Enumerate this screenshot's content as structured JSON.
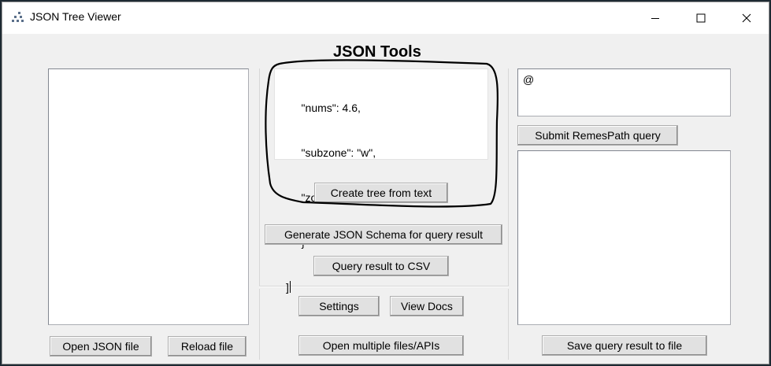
{
  "window": {
    "title": "JSON Tree Viewer",
    "controls": {
      "minimize_icon": "minimize-icon",
      "maximize_icon": "maximize-icon",
      "close_icon": "close-icon"
    }
  },
  "heading": "JSON Tools",
  "json_text": {
    "lines": [
      "    \"nums\": 4.6,",
      "    \"subzone\": \"w\",",
      "    \"zone\": 5",
      "    }",
      "]"
    ]
  },
  "buttons": {
    "create_tree": "Create tree from text",
    "generate_schema": "Generate JSON Schema for query result",
    "query_to_csv": "Query result to CSV",
    "settings": "Settings",
    "view_docs": "View Docs",
    "open_multiple": "Open multiple files/APIs",
    "open_json": "Open JSON file",
    "reload_file": "Reload file",
    "submit_query": "Submit RemesPath query",
    "save_query": "Save query result to file"
  },
  "query": {
    "value": "@"
  },
  "colors": {
    "window_bg": "#f0f0f0",
    "button_bg": "#e1e1e1",
    "annotation": "#000000"
  }
}
